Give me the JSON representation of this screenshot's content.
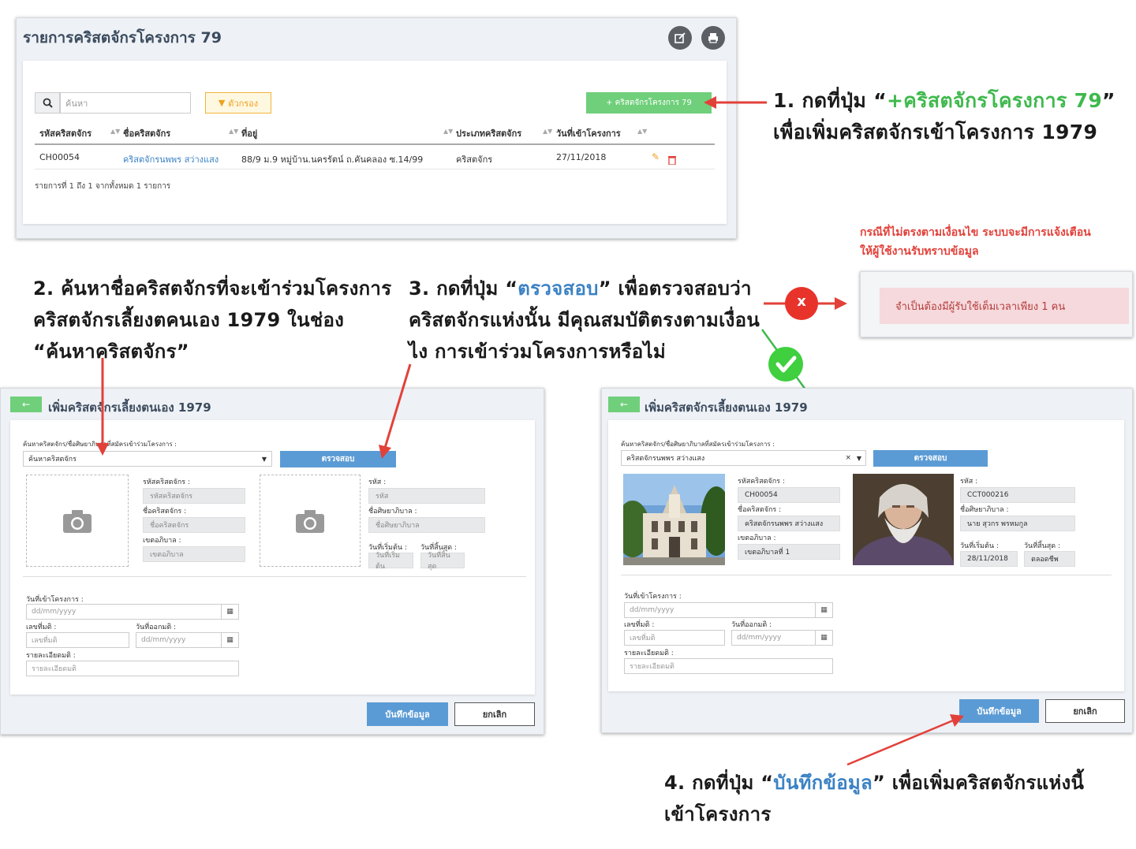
{
  "list_panel": {
    "title": "รายการคริสตจักรโครงการ 79",
    "search_placeholder": "ค้นหา",
    "filter_label": "ตัวกรอง",
    "add_button": "+ คริสตจักรโครงการ 79",
    "columns": [
      "รหัสคริสตจักร",
      "ชื่อคริสตจักร",
      "ที่อยู่",
      "ประเภทคริสตจักร",
      "วันที่เข้าโครงการ"
    ],
    "rows": [
      {
        "code": "CH00054",
        "name": "คริสตจักรนพพร สว่างแสง",
        "address": "88/9 ม.9 หมู่บ้าน.นครรัตน์ ถ.คันคลอง ซ.14/99",
        "type": "คริสตจักร",
        "date": "27/11/2018"
      }
    ],
    "footer": "รายการที่ 1 ถึง 1 จากทั้งหมด 1 รายการ"
  },
  "annotations": {
    "step1_prefix": "1. กดที่ปุ่ม “",
    "step1_highlight": "+คริสตจักรโครงการ 79",
    "step1_suffix": "”",
    "step1_line2": "เพื่อเพิ่มคริสตจักรเข้าโครงการ 1979",
    "step2_line1": "2. ค้นหาชื่อคริสตจักรที่จะเข้าร่วมโครงการ",
    "step2_line2": "คริสตจักรเลี้ยงตคนเอง 1979 ในช่อง",
    "step2_line3": "“ค้นหาคริสตจักร”",
    "step3_prefix": "3. กดที่ปุ่ม “",
    "step3_highlight": "ตรวจสอบ",
    "step3_suffix": "” เพื่อตรวจสอบว่า",
    "step3_line2": "คริสตจักรแห่งนั้น มีคุณสมบัติตรงตามเงื่อน",
    "step3_line3": "ไง การเข้าร่วมโครงการหรือไม่",
    "step4_prefix": "4. กดที่ปุ่ม “",
    "step4_highlight": "บันทึกข้อมูล",
    "step4_suffix": "” เพื่อเพิ่มคริสตจักรแห่งนี้",
    "step4_line2": "เข้าโครงการ",
    "warn_line1": "กรณีที่ไม่ตรงตามเงื่อนไข ระบบจะมีการแจ้งเตือน",
    "warn_line2": "ให้ผู้ใช้งานรับทราบข้อมูล",
    "x_mark": "x"
  },
  "alert_text": "จำเป็นต้องมีผู้รับใช้เต็มเวลาเพียง 1 คน",
  "form_left": {
    "back": "←",
    "title": "เพิ่มคริสตจักรเลี้ยงตนเอง 1979",
    "search_label": "ค้นหาคริสตจักร/ชื่อศิษยาภิบาลที่สมัครเข้าร่วมโครงการ :",
    "search_value": "ค้นหาคริสตจักร",
    "check_button": "ตรวจสอบ",
    "church_code_label": "รหัสคริสตจักร :",
    "church_code_ph": "รหัสคริสตจักร",
    "church_name_label": "ชื่อคริสตจักร :",
    "church_name_ph": "ชื่อคริสตจักร",
    "district_label": "เขตอภิบาล :",
    "district_ph": "เขตอภิบาล",
    "code_label": "รหัส :",
    "code_ph": "รหัส",
    "pastor_label": "ชื่อศิษยาภิบาล :",
    "pastor_ph": "ชื่อศิษยาภิบาล",
    "start_label": "วันที่เริ่มต้น :",
    "start_ph": "วันที่เริ่มต้น",
    "end_label": "วันที่สิ้นสุด :",
    "end_ph": "วันที่สิ้นสุด",
    "join_date_label": "วันที่เข้าโครงการ :",
    "date_ph": "dd/mm/yyyy",
    "res_no_label": "เลขที่มติ :",
    "res_no_ph": "เลขที่มติ",
    "res_date_label": "วันที่ออกมติ :",
    "res_detail_label": "รายละเอียดมติ :",
    "res_detail_ph": "รายละเอียดมติ",
    "save": "บันทึกข้อมูล",
    "cancel": "ยกเลิก"
  },
  "form_right": {
    "search_value": "คริสตจักรนพพร สว่างแสง",
    "clear": "×",
    "church_code": "CH00054",
    "church_name": "คริสตจักรนพพร สว่างแสง",
    "district": "เขตอภิบาลที่ 1",
    "code": "CCT000216",
    "pastor": "นาย สุวกร พรหมกูล",
    "start": "28/11/2018",
    "end": "ตลอดชีพ"
  },
  "colors": {
    "accent_green": "#3fb94d",
    "accent_blue": "#3b82c4",
    "arrow_red": "#e2413a",
    "button_blue": "#5b9bd5"
  },
  "icons": [
    "edit-icon",
    "print-icon",
    "search-icon",
    "filter-icon",
    "trash-icon",
    "camera-icon",
    "calendar-icon",
    "check-icon",
    "x-icon",
    "back-arrow-icon",
    "caret-down-icon"
  ]
}
